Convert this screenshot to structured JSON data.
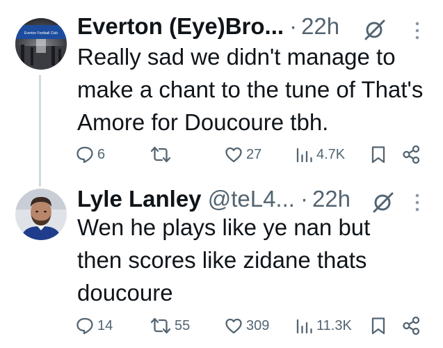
{
  "tweets": [
    {
      "display_name": "Everton (Eye)Bro...",
      "handle": "",
      "dot": "·",
      "time": "22h",
      "text": "Really sad we didn't manage to make a chant to the tune of That's Amore for Doucoure tbh.",
      "avatar_caption": "Everton Football Club",
      "replies": "6",
      "reposts": "",
      "likes": "27",
      "views": "4.7K"
    },
    {
      "display_name": "Lyle Lanley",
      "handle": "@teL4...",
      "dot": "·",
      "time": "22h",
      "text": "Wen he plays like ye nan but then scores like zidane thats doucoure",
      "replies": "14",
      "reposts": "55",
      "likes": "309",
      "views": "11.3K"
    }
  ],
  "icons": {
    "reply": "reply-icon",
    "repost": "repost-icon",
    "like": "heart-icon",
    "views": "views-icon",
    "bookmark": "bookmark-icon",
    "share": "share-icon",
    "grok": "grok-icon",
    "more": "more-icon"
  },
  "colors": {
    "text": "#0f1419",
    "secondary": "#536471",
    "thread_line": "#cfd9de"
  }
}
